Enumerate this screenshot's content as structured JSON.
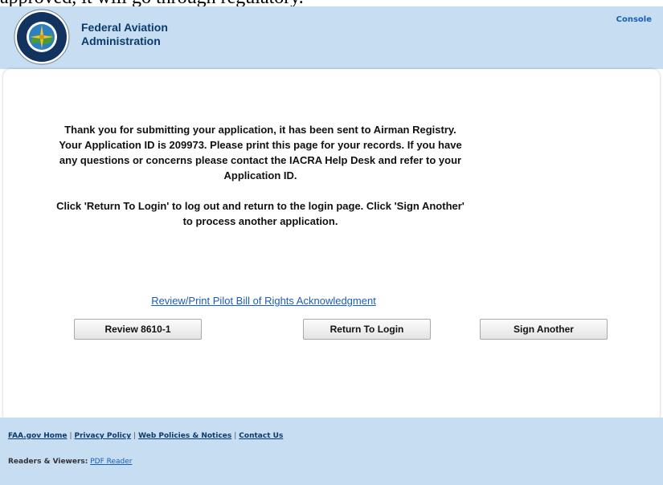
{
  "top_fragment": "approved, it will go through regulatory.",
  "header": {
    "agency_line1": "Federal Aviation",
    "agency_line2": "Administration",
    "console_link": "Console",
    "seal_text_top": "FEDERAL AVIATION",
    "seal_text_bottom": "ADMINISTRATION"
  },
  "main": {
    "message_paragraph1": "Thank you for submitting your application, it has been sent to Airman Registry. Your Application ID is 209973. Please print this page for your records. If you have any questions or concerns please contact the IACRA Help Desk and refer to your Application ID.",
    "message_paragraph2": "Click 'Return To Login' to log out and return to the login page. Click 'Sign Another' to process another application.",
    "pbor_link": "Review/Print Pilot Bill of Rights Acknowledgment",
    "buttons": {
      "review": "Review 8610-1",
      "return": "Return To Login",
      "sign": "Sign Another"
    }
  },
  "footer": {
    "links": [
      "FAA.gov Home",
      "Privacy Policy",
      "Web Policies & Notices",
      "Contact Us"
    ],
    "readers_label": "Readers & Viewers:",
    "pdf_reader": "PDF Reader"
  },
  "colors": {
    "header_bg": "#c6ddf2",
    "agency_text": "#0b3a6b",
    "link": "#1a5fb4"
  }
}
